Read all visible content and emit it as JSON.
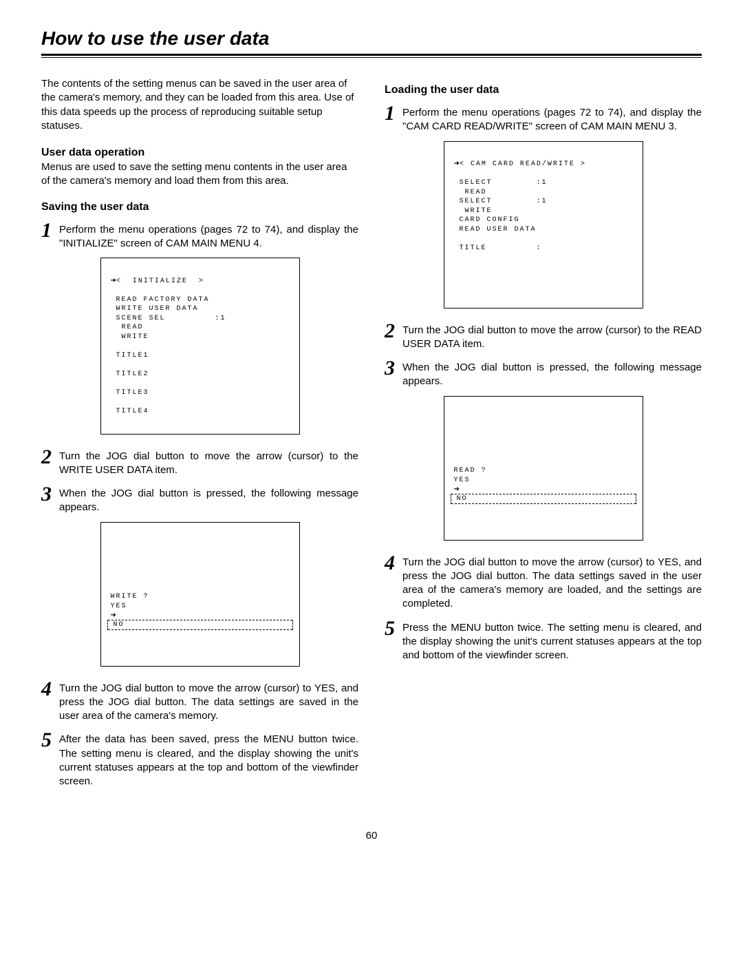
{
  "page_title": "How to use the user data",
  "page_number": "60",
  "left": {
    "intro": "The contents of the setting menus can be saved in the user area of the camera's memory, and they can be loaded from this area.  Use of this data speeds up the process of reproducing suitable setup statuses.",
    "sec1_head": "User data operation",
    "sec1_text": "Menus are used to save the setting menu contents in the user area of the camera's memory and load them from this area.",
    "sec2_head": "Saving the user data",
    "step1": "Perform the menu operations (pages 72 to 74), and display the \"INITIALIZE\" screen of CAM MAIN MENU 4.",
    "screen1": {
      "title": "<  INITIALIZE  >",
      "lines": [
        " READ FACTORY DATA",
        " WRITE USER DATA",
        " SCENE SEL         :1",
        "  READ",
        "  WRITE",
        "",
        " TITLE1",
        "",
        " TITLE2",
        "",
        " TITLE3",
        "",
        " TITLE4"
      ]
    },
    "step2": "Turn the JOG dial button to move the arrow (cursor) to the WRITE USER DATA item.",
    "step3": "When the JOG dial button is pressed, the following message appears.",
    "screen2": {
      "prompt": "WRITE ?",
      "yes": "YES",
      "no": "NO"
    },
    "step4": "Turn the JOG dial button to move the arrow (cursor) to YES, and press the JOG dial button.\nThe data settings are saved in the user area of the camera's memory.",
    "step5": "After the data has been saved, press the MENU button twice.\nThe setting menu is cleared, and the display showing the unit's current statuses appears at the top and bottom of the viewfinder screen."
  },
  "right": {
    "sec1_head": "Loading the user data",
    "step1": "Perform the menu operations (pages 72 to 74), and display the \"CAM CARD READ/WRITE\" screen of CAM MAIN MENU 3.",
    "screen1": {
      "title": "< CAM CARD READ/WRITE >",
      "lines": [
        " SELECT        :1",
        "  READ",
        " SELECT        :1",
        "  WRITE",
        " CARD CONFIG",
        " READ USER DATA",
        "",
        " TITLE         :"
      ]
    },
    "step2": "Turn the JOG dial button to move the arrow (cursor) to the READ USER DATA item.",
    "step3": "When the JOG dial button is pressed, the following message appears.",
    "screen2": {
      "prompt": "READ ?",
      "yes": "YES",
      "no": "NO"
    },
    "step4": "Turn the JOG dial button to move the arrow (cursor) to YES, and press the JOG dial button.\nThe data settings saved in the user area of the camera's memory are loaded, and the settings are completed.",
    "step5": "Press the MENU button twice.\nThe setting menu is cleared, and the display showing the unit's current statuses appears at the top and bottom of the viewfinder screen."
  }
}
